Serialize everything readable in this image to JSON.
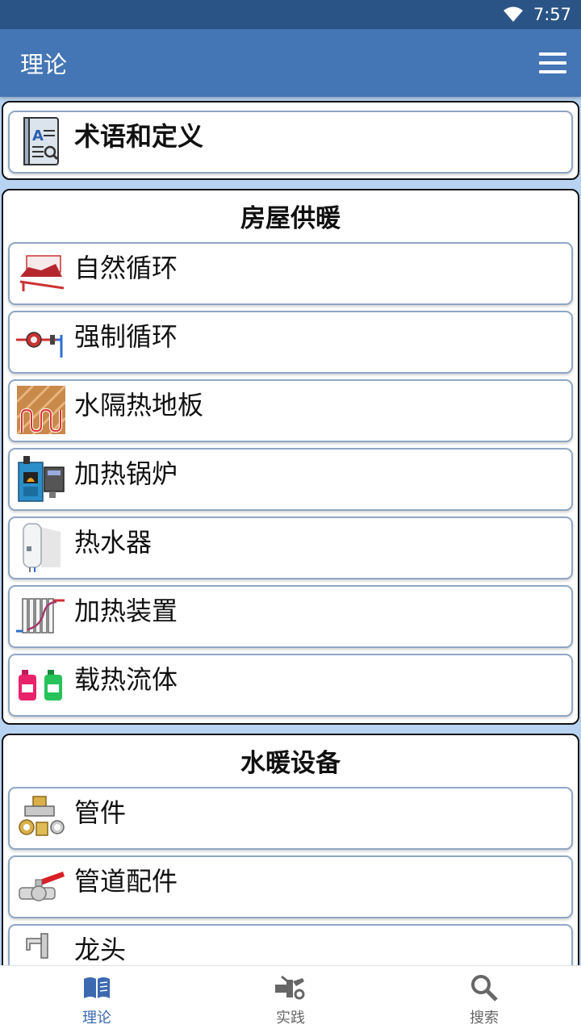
{
  "status_bar": {
    "time": "7:57"
  },
  "app_bar": {
    "title": "理论"
  },
  "sections": {
    "terms": {
      "label": "术语和定义"
    },
    "heating": {
      "title": "房屋供暖",
      "items": [
        {
          "label": "自然循环",
          "icon": "natural-circulation-icon"
        },
        {
          "label": "强制循环",
          "icon": "forced-circulation-pump-icon"
        },
        {
          "label": "水隔热地板",
          "icon": "underfloor-heating-icon"
        },
        {
          "label": "加热锅炉",
          "icon": "boiler-icon"
        },
        {
          "label": "热水器",
          "icon": "water-heater-icon"
        },
        {
          "label": "加热装置",
          "icon": "radiator-icon"
        },
        {
          "label": "载热流体",
          "icon": "coolant-bottles-icon"
        }
      ]
    },
    "equipment": {
      "title": "水暖设备",
      "items": [
        {
          "label": "管件",
          "icon": "pipe-fittings-icon"
        },
        {
          "label": "管道配件",
          "icon": "ball-valve-icon"
        },
        {
          "label": "龙头",
          "icon": "faucet-icon"
        }
      ]
    }
  },
  "bottom_nav": {
    "theory": "理论",
    "practice": "实践",
    "search": "搜索"
  },
  "colors": {
    "status_bar": "#2b5486",
    "app_bar": "#4475b4",
    "background": "#b8d3f2",
    "active_nav": "#3b6ab0"
  }
}
